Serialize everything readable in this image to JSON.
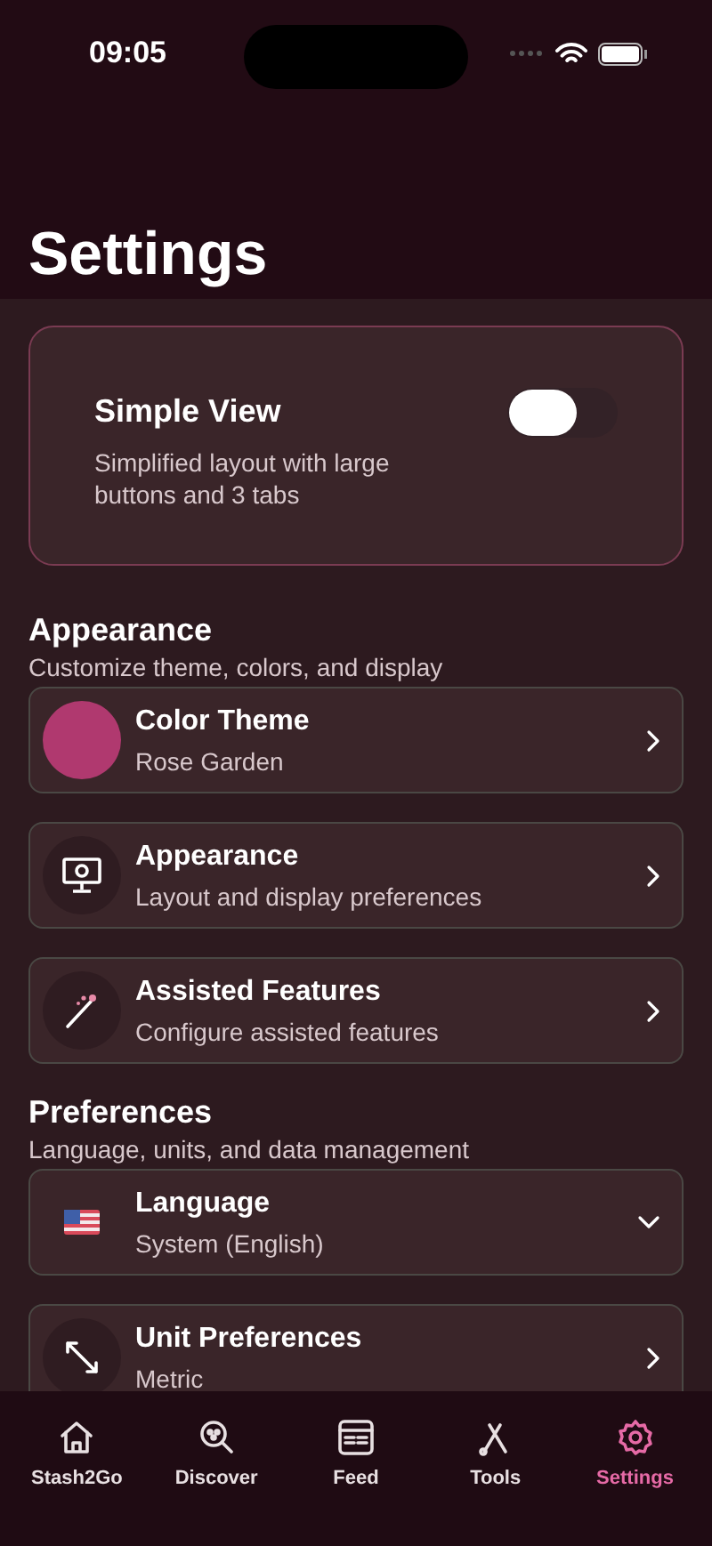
{
  "status_bar": {
    "time": "09:05"
  },
  "title": "Settings",
  "simple_view": {
    "title": "Simple View",
    "description": "Simplified layout with large buttons and 3 tabs",
    "on": false
  },
  "sections": [
    {
      "title": "Appearance",
      "subtitle": "Customize theme, colors, and display",
      "items": [
        {
          "kind": "swatch",
          "title": "Color Theme",
          "subtitle": "Rose Garden",
          "color": "#b0396f",
          "dropdown": false
        },
        {
          "kind": "monitor",
          "title": "Appearance",
          "subtitle": "Layout and display preferences",
          "dropdown": false
        },
        {
          "kind": "wand",
          "title": "Assisted Features",
          "subtitle": "Configure assisted features",
          "dropdown": false
        }
      ]
    },
    {
      "title": "Preferences",
      "subtitle": "Language, units, and data management",
      "items": [
        {
          "kind": "flag",
          "title": "Language",
          "subtitle": "System (English)",
          "dropdown": true
        },
        {
          "kind": "resize",
          "title": "Unit Preferences",
          "subtitle": "Metric",
          "dropdown": false
        }
      ]
    }
  ],
  "tabs": [
    {
      "kind": "home",
      "label": "Stash2Go",
      "selected": false
    },
    {
      "kind": "discover",
      "label": "Discover",
      "selected": false
    },
    {
      "kind": "feed",
      "label": "Feed",
      "selected": false
    },
    {
      "kind": "tools",
      "label": "Tools",
      "selected": false
    },
    {
      "kind": "settings",
      "label": "Settings",
      "selected": true
    }
  ]
}
